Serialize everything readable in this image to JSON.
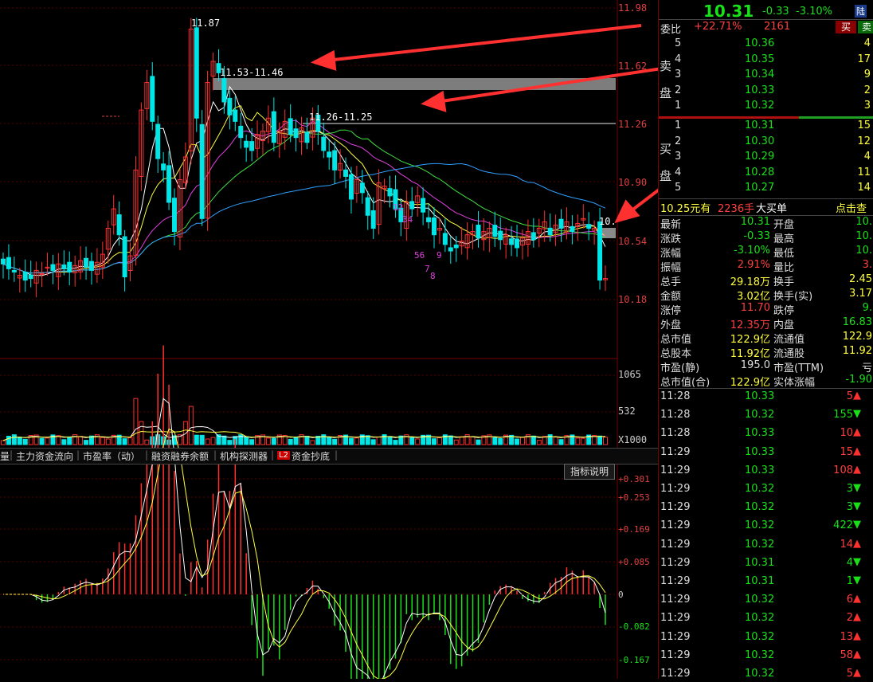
{
  "main_chart": {
    "y_axis_labels": [
      "11.98",
      "11.62",
      "11.26",
      "10.90",
      "10.54",
      "10.18"
    ],
    "annotations": {
      "high_label": "11.87",
      "zone1_label": "11.53-11.46",
      "zone2_label": "11.26-11.25",
      "right_cut_label": "10.",
      "wave_labels": [
        "12",
        "34",
        "56",
        "7",
        "8",
        "9"
      ]
    }
  },
  "volume_chart": {
    "axis_labels": [
      "1065",
      "532",
      "X1000"
    ]
  },
  "tabs": {
    "items": [
      "量",
      "主力资金流向",
      "市盈率（动）",
      "融资融券余额",
      "机构探测器",
      "L2",
      "资金抄底"
    ],
    "indicator_button": "指标说明"
  },
  "indicator_chart": {
    "axis_labels": [
      "+0.301",
      "+0.253",
      "+0.169",
      "+0.085",
      "0",
      "-0.082",
      "-0.167"
    ]
  },
  "chart_data": {
    "type": "candlestick",
    "ylim": [
      10.1,
      12.0
    ],
    "y_ticks": [
      11.98,
      11.62,
      11.26,
      10.9,
      10.54,
      10.18
    ],
    "high_marker": 11.87,
    "resistance_zones": [
      {
        "label": "11.53-11.46",
        "low": 11.46,
        "high": 11.53
      },
      {
        "label": "11.26-11.25",
        "low": 11.25,
        "high": 11.26
      }
    ],
    "last_price": 10.31,
    "indicator_ylim": [
      -0.2,
      0.32
    ],
    "indicator_ticks": [
      0.301,
      0.253,
      0.169,
      0.085,
      0,
      -0.082,
      -0.167
    ]
  },
  "quote": {
    "price": "10.31",
    "change": "-0.33",
    "change_pct": "-3.10%",
    "market_badge": "陆",
    "weibi_label": "委比",
    "weibi_value": "+22.71%",
    "weicha_value": "2161",
    "buy_button": "买",
    "sell_button": "卖",
    "sell_side_label": "卖盘",
    "buy_side_label": "买盘",
    "asks": [
      {
        "level": "5",
        "price": "10.36",
        "vol": "4"
      },
      {
        "level": "4",
        "price": "10.35",
        "vol": "17"
      },
      {
        "level": "3",
        "price": "10.34",
        "vol": "9"
      },
      {
        "level": "2",
        "price": "10.33",
        "vol": "2"
      },
      {
        "level": "1",
        "price": "10.32",
        "vol": "3"
      }
    ],
    "bids": [
      {
        "level": "1",
        "price": "10.31",
        "vol": "15"
      },
      {
        "level": "2",
        "price": "10.30",
        "vol": "12"
      },
      {
        "level": "3",
        "price": "10.29",
        "vol": "4"
      },
      {
        "level": "4",
        "price": "10.28",
        "vol": "11"
      },
      {
        "level": "5",
        "price": "10.27",
        "vol": "14"
      }
    ],
    "big_order": {
      "price": "10.25元有",
      "qty": "2236手",
      "label": "大买单",
      "action": "点击查"
    },
    "stats": [
      {
        "l1": "最新",
        "v1": "10.31",
        "c1": "green",
        "l2": "开盘",
        "v2": "10.",
        "c2": "green"
      },
      {
        "l1": "涨跌",
        "v1": "-0.33",
        "c1": "green",
        "l2": "最高",
        "v2": "10.",
        "c2": "green"
      },
      {
        "l1": "涨幅",
        "v1": "-3.10%",
        "c1": "green",
        "l2": "最低",
        "v2": "10.",
        "c2": "green"
      },
      {
        "l1": "振幅",
        "v1": "2.91%",
        "c1": "red",
        "l2": "量比",
        "v2": "3.",
        "c2": "red"
      },
      {
        "l1": "总手",
        "v1": "29.18万",
        "c1": "yellow",
        "l2": "换手",
        "v2": "2.45",
        "c2": "yellow"
      },
      {
        "l1": "金额",
        "v1": "3.02亿",
        "c1": "yellow",
        "l2": "换手(实)",
        "v2": "3.17",
        "c2": "yellow"
      },
      {
        "l1": "涨停",
        "v1": "11.70",
        "c1": "red",
        "l2": "跌停",
        "v2": "9.",
        "c2": "green"
      },
      {
        "l1": "外盘",
        "v1": "12.35万",
        "c1": "red",
        "l2": "内盘",
        "v2": "16.83",
        "c2": "green"
      },
      {
        "l1": "总市值",
        "v1": "122.9亿",
        "c1": "yellow",
        "l2": "流通值",
        "v2": "122.9",
        "c2": "yellow"
      },
      {
        "l1": "总股本",
        "v1": "11.92亿",
        "c1": "yellow",
        "l2": "流通股",
        "v2": "11.92",
        "c2": "yellow"
      },
      {
        "l1": "市盈(静)",
        "v1": "195.0",
        "c1": "white",
        "l2": "市盈(TTM)",
        "v2": "亏",
        "c2": "white"
      },
      {
        "l1": "总市值(合)",
        "v1": "122.9亿",
        "c1": "yellow",
        "l2": "实体涨幅",
        "v2": "-1.90",
        "c2": "green"
      }
    ],
    "ticks": [
      {
        "time": "11:28",
        "price": "10.33",
        "vol": "5",
        "dir": "up"
      },
      {
        "time": "11:28",
        "price": "10.32",
        "vol": "155",
        "dir": "down"
      },
      {
        "time": "11:28",
        "price": "10.33",
        "vol": "10",
        "dir": "up"
      },
      {
        "time": "11:29",
        "price": "10.33",
        "vol": "15",
        "dir": "up"
      },
      {
        "time": "11:29",
        "price": "10.33",
        "vol": "108",
        "dir": "up"
      },
      {
        "time": "11:29",
        "price": "10.32",
        "vol": "3",
        "dir": "down"
      },
      {
        "time": "11:29",
        "price": "10.32",
        "vol": "3",
        "dir": "down"
      },
      {
        "time": "11:29",
        "price": "10.32",
        "vol": "422",
        "dir": "down"
      },
      {
        "time": "11:29",
        "price": "10.32",
        "vol": "14",
        "dir": "up"
      },
      {
        "time": "11:29",
        "price": "10.31",
        "vol": "4",
        "dir": "down"
      },
      {
        "time": "11:29",
        "price": "10.31",
        "vol": "1",
        "dir": "down"
      },
      {
        "time": "11:29",
        "price": "10.32",
        "vol": "6",
        "dir": "up"
      },
      {
        "time": "11:29",
        "price": "10.32",
        "vol": "2",
        "dir": "up"
      },
      {
        "time": "11:29",
        "price": "10.32",
        "vol": "13",
        "dir": "up"
      },
      {
        "time": "11:29",
        "price": "10.32",
        "vol": "58",
        "dir": "up"
      },
      {
        "time": "11:29",
        "price": "10.32",
        "vol": "5",
        "dir": "up"
      }
    ]
  }
}
